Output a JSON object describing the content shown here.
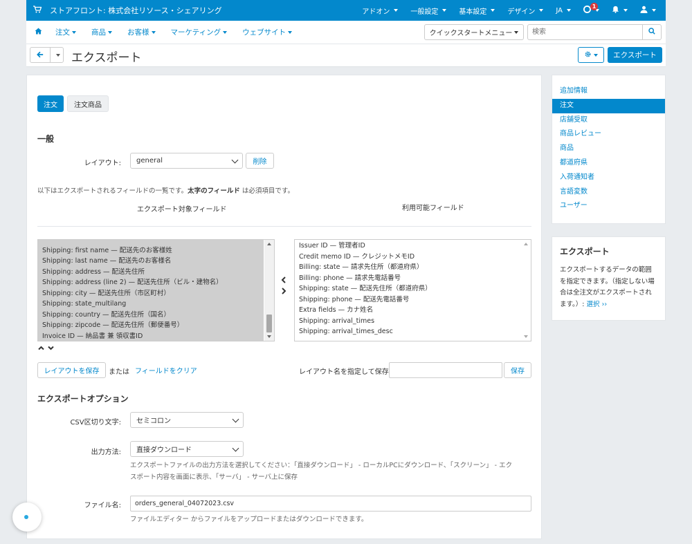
{
  "topbar": {
    "store_name": "ストアフロント: 株式会社リソース・シェアリング",
    "menu": [
      "アドオン",
      "一般設定",
      "基本設定",
      "デザイン",
      "JA"
    ],
    "notification_count": "1"
  },
  "nav": {
    "items": [
      "注文",
      "商品",
      "お客様",
      "マーケティング",
      "ウェブサイト"
    ],
    "quickstart_label": "クイックスタートメニュー",
    "search_placeholder": "検索"
  },
  "titlebar": {
    "title": "エクスポート",
    "export_button": "エクスポート"
  },
  "main": {
    "tabs": [
      "注文",
      "注文商品"
    ],
    "general_heading": "一般",
    "layout_label": "レイアウト:",
    "layout_value": "general",
    "delete_button": "削除",
    "info_prefix": "以下はエクスポートされるフィールドの一覧です。",
    "info_bold": "太字のフィールド",
    "info_suffix": " は必須項目です。",
    "export_fields_heading": "エクスポート対象フィールド",
    "available_fields_heading": "利用可能フィールド",
    "export_fields": [
      "Shipping: first name — 配送先のお客様姓",
      "Shipping: last name — 配送先のお客様名",
      "Shipping: address — 配送先住所",
      "Shipping: address (line 2) — 配送先住所（ビル・建物名）",
      "Shipping: city — 配送先住所（市区町村）",
      "Shipping: state_multilang",
      "Shipping: country — 配送先住所（国名）",
      "Shipping: zipcode — 配送先住所（郵便番号）",
      "Invoice ID — 納品書 兼 領収書ID"
    ],
    "available_fields": [
      "Issuer ID — 管理者ID",
      "Credit memo ID — クレジットメモID",
      "Billing: state — 請求先住所（都道府県）",
      "Billing: phone — 請求先電話番号",
      "Shipping: state — 配送先住所（都道府県）",
      "Shipping: phone — 配送先電話番号",
      "Extra fields — カナ姓名",
      "Shipping: arrival_times",
      "Shipping: arrival_times_desc"
    ],
    "save_layout_button": "レイアウトを保存",
    "or_text": "または",
    "clear_fields_link": "フィールドをクリア",
    "save_as_label": "レイアウト名を指定して保存:",
    "save_as_value": "",
    "save_button": "保存",
    "options_heading": "エクスポートオプション",
    "csv_delimiter_label": "CSV区切り文字:",
    "csv_delimiter_value": "セミコロン",
    "output_label": "出力方法:",
    "output_value": "直接ダウンロード",
    "output_help_line1": "エクスポートファイルの出力方法を選択してください：「直接ダウンロード」 - ローカルPCにダウンロード、「スクリーン」 - エク",
    "output_help_line2": "スポート内容を画面に表示、「サーバ」 - サーバ上に保存",
    "filename_label": "ファイル名:",
    "filename_value": "orders_general_04072023.csv",
    "file_editor_link": "ファイルエディター",
    "file_help_suffix": " からファイルをアップロードまたはダウンロードできます。"
  },
  "sidebar": {
    "items": [
      "追加情報",
      "注文",
      "店舗受取",
      "商品レビュー",
      "商品",
      "都道府県",
      "入荷通知者",
      "言語変数",
      "ユーザー"
    ],
    "active_index": 1,
    "box_title": "エクスポート",
    "box_text": "エクスポートするデータの範囲を指定できます。（指定しない場合は全注文がエクスポートされます。）:",
    "box_link": "選択 ››"
  },
  "colors": {
    "accent": "#0388cc",
    "badge": "#d9383a"
  }
}
